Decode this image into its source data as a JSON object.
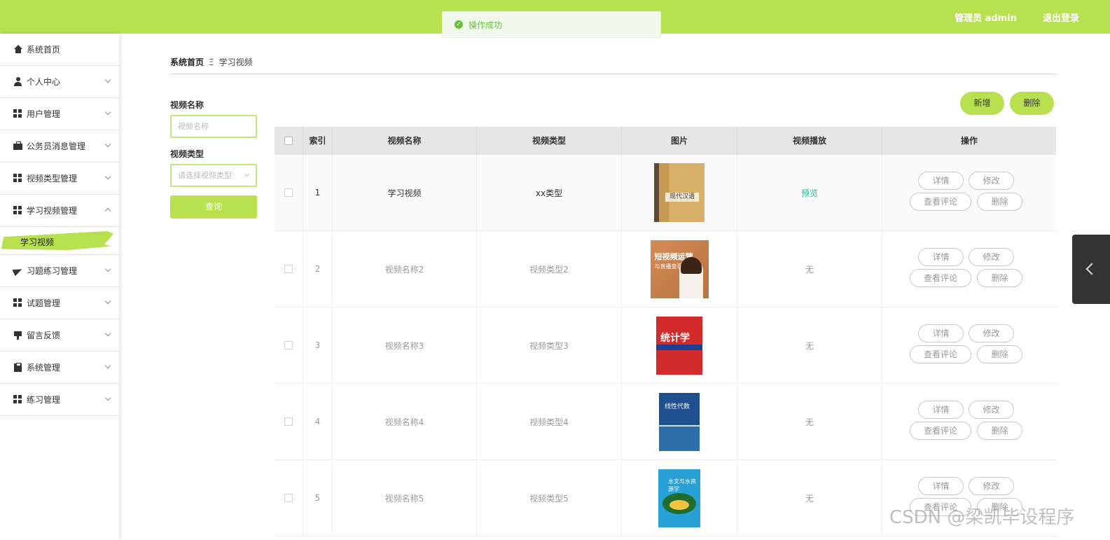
{
  "header": {
    "user": "管理员 admin",
    "logout": "退出登录"
  },
  "toast": {
    "message": "操作成功"
  },
  "sidebar": {
    "items": [
      {
        "label": "系统首页",
        "icon": "home-icon"
      },
      {
        "label": "个人中心",
        "icon": "user-icon"
      },
      {
        "label": "用户管理",
        "icon": "grid-icon"
      },
      {
        "label": "公务员消息管理",
        "icon": "briefcase-icon"
      },
      {
        "label": "视频类型管理",
        "icon": "grid-icon"
      },
      {
        "label": "学习视频管理",
        "icon": "grid-icon"
      },
      {
        "label": "习题练习管理",
        "icon": "paper-plane-icon"
      },
      {
        "label": "试题管理",
        "icon": "grid-icon"
      },
      {
        "label": "留言反馈",
        "icon": "message-icon"
      },
      {
        "label": "系统管理",
        "icon": "clipboard-icon"
      },
      {
        "label": "练习管理",
        "icon": "grid-icon"
      }
    ],
    "active_sub": "学习视频"
  },
  "breadcrumb": {
    "home": "系统首页",
    "sep": "Ξ",
    "current": "学习视频"
  },
  "search": {
    "name_label": "视频名称",
    "name_placeholder": "视频名称",
    "type_label": "视频类型",
    "type_placeholder": "请选择视频类型",
    "button": "查询"
  },
  "actions": {
    "add": "新增",
    "delete": "删除"
  },
  "table": {
    "headers": [
      "索引",
      "视频名称",
      "视频类型",
      "图片",
      "视频播放",
      "操作"
    ],
    "rows": [
      {
        "index": "1",
        "name": "学习视频",
        "type": "xx类型",
        "play": "预览"
      },
      {
        "index": "2",
        "name": "视频名称2",
        "type": "视频类型2",
        "play": "无"
      },
      {
        "index": "3",
        "name": "视频名称3",
        "type": "视频类型3",
        "play": "无"
      },
      {
        "index": "4",
        "name": "视频名称4",
        "type": "视频类型4",
        "play": "无"
      },
      {
        "index": "5",
        "name": "视频名称5",
        "type": "视频类型5",
        "play": "无"
      }
    ],
    "ops": {
      "detail": "详情",
      "edit": "修改",
      "comment": "查看评论",
      "delete": "删除"
    },
    "covers": [
      {
        "title": "现代汉语"
      },
      {
        "title": "短视频运营",
        "subtitle": "与直播变现"
      },
      {
        "title": "统计学"
      },
      {
        "title": "线性代数"
      },
      {
        "title": "水文与水资源学"
      }
    ]
  },
  "watermark": "CSDN @梁凯毕设程序",
  "colors": {
    "brand": "#b8e04f",
    "success": "#67c23a",
    "link": "#3bb39b"
  }
}
